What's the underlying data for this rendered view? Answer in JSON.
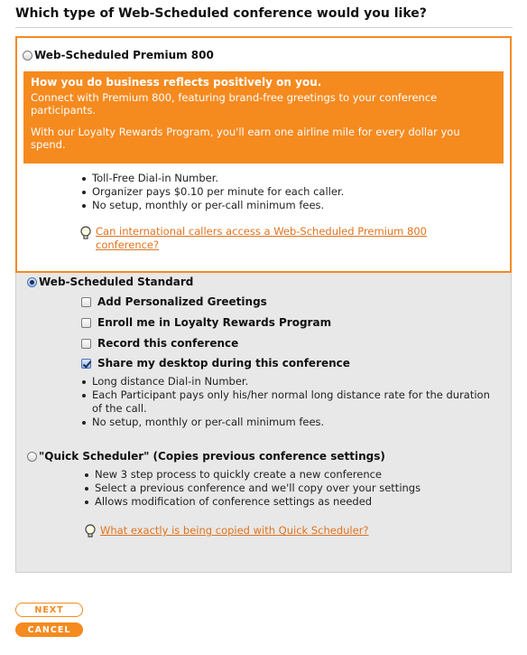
{
  "page": {
    "heading": "Which type of Web-Scheduled conference would you like?"
  },
  "colors": {
    "accent": "#f58a1f",
    "panel": "#e8e8e8",
    "link": "#e0731e"
  },
  "premium": {
    "title": "Web-Scheduled Premium 800",
    "selected": false,
    "banner_heading": "How you do business reflects positively on you.",
    "banner_para1": "Connect with Premium 800, featuring brand-free greetings to your conference participants.",
    "banner_para2": "With our Loyalty Rewards Program, you'll earn one airline mile for every dollar you spend.",
    "bullets": [
      "Toll-Free Dial-in Number.",
      "Organizer pays $0.10 per minute for each caller.",
      "No setup, monthly or per-call minimum fees."
    ],
    "help_link": "Can international callers access a Web-Scheduled Premium 800 conference?",
    "help_icon": "lightbulb-icon"
  },
  "standard": {
    "title": "Web-Scheduled Standard",
    "selected": true,
    "options": [
      {
        "label": "Add Personalized Greetings",
        "checked": false
      },
      {
        "label": "Enroll me in Loyalty Rewards Program",
        "checked": false
      },
      {
        "label": "Record this conference",
        "checked": false
      },
      {
        "label": "Share my desktop during this conference",
        "checked": true
      }
    ],
    "bullets": [
      "Long distance Dial-in Number.",
      "Each Participant pays only his/her normal long distance rate for the duration of the call.",
      "No setup, monthly or per-call minimum fees."
    ]
  },
  "quick": {
    "title": "\"Quick Scheduler\" (Copies previous conference settings)",
    "selected": false,
    "bullets": [
      "New 3 step process to quickly create a new conference",
      "Select a previous conference and we'll copy over your settings",
      "Allows modification of conference settings as needed"
    ],
    "help_link": "What exactly is being copied with Quick Scheduler?",
    "help_icon": "lightbulb-icon"
  },
  "buttons": {
    "next": "NEXT",
    "cancel": "CANCEL"
  }
}
